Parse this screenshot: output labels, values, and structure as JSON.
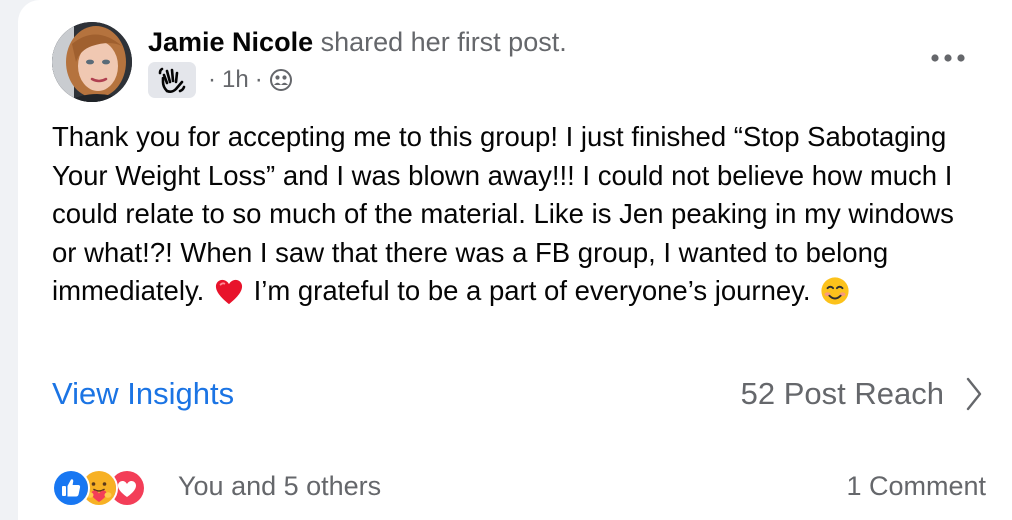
{
  "post": {
    "author_name": "Jamie Nicole",
    "author_action": "shared her first post.",
    "badge_icon": "waving-hand-icon",
    "time": "1h",
    "separator": "·",
    "privacy_icon": "group-privacy-icon",
    "more_icon": "more-options-icon",
    "text_part1": "Thank you for accepting me to this group! I just finished “Stop Sabotaging Your Weight Loss” and I was blown away!!! I could not believe how much I could relate to so much of the material. Like is Jen peaking in my windows or what!?! When I saw that there was a FB group, I wanted to belong immediately.",
    "text_part2": "I’m grateful to be a part of everyone’s journey.",
    "emoji_1": "red-heart-emoji",
    "emoji_2": "smiling-face-emoji"
  },
  "insights": {
    "link_label": "View Insights",
    "reach_label": "52 Post Reach"
  },
  "footer": {
    "reaction_icons": [
      "like-icon",
      "care-icon",
      "love-icon"
    ],
    "reactions_text": "You and 5 others",
    "comments_text": "1 Comment"
  },
  "colors": {
    "link_blue": "#1b74e4",
    "secondary_text": "#65676b",
    "primary_text": "#050505",
    "like_blue": "#1877f2",
    "love_red": "#f33e58",
    "care_yellow": "#f7b125"
  }
}
